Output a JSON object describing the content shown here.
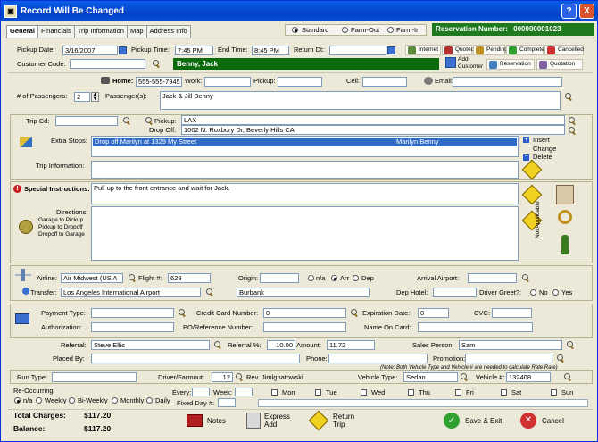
{
  "window": {
    "title": "Record Will Be Changed",
    "help": "?",
    "close": "X"
  },
  "tabs": [
    "General",
    "Financials",
    "Trip Information",
    "Map",
    "Address Info"
  ],
  "service_type": {
    "options": [
      "Standard",
      "Farm-Out",
      "Farm-In"
    ],
    "selected": "Standard"
  },
  "reservation": {
    "label": "Reservation Number:",
    "value": "000000001023"
  },
  "pickup": {
    "date_label": "Pickup Date:",
    "date": "3/16/2007",
    "time_label": "Pickup Time:",
    "time": "7:45 PM",
    "end_label": "End Time:",
    "end": "8:45 PM",
    "return_label": "Return Dt:",
    "return": ""
  },
  "status_buttons": {
    "internet": "Internet",
    "quoted": "Quoted",
    "pending": "Pending",
    "completed": "Completed",
    "cancelled": "Cancelled",
    "add_customer": "Add Customer",
    "reservation": "Reservation",
    "quotation": "Quotation"
  },
  "customer": {
    "code_label": "Customer Code:",
    "code": "",
    "name": "Benny, Jack",
    "home_label": "Home:",
    "home": "555-555-7945",
    "work_label": "Work:",
    "work": "",
    "pickup_label": "Pickup:",
    "pickup": "",
    "cell_label": "Cell:",
    "cell": "",
    "email_label": "Email:",
    "email": ""
  },
  "passengers": {
    "count_label": "# of Passengers:",
    "count": "2",
    "names_label": "Passenger(s):",
    "names": "Jack & Jill Benny"
  },
  "trip": {
    "cd_label": "Trip Cd:",
    "cd": "",
    "pickup_label": "Pickup:",
    "pickup": "LAX",
    "dropoff_label": "Drop Off:",
    "dropoff": "1002 N. Roxbury Dr, Beverly Hills CA",
    "extra_label": "Extra Stops:",
    "extra_stop": "Drop off Marilyn at 1329 My Street",
    "extra_stop_name": "Marilyn Benny",
    "insert": "Insert",
    "change": "Change",
    "delete": "Delete",
    "info_label": "Trip Information:"
  },
  "special": {
    "label": "Special Instructions:",
    "text": "Pull up to the front entrance and wait for Jack.",
    "directions_label": "Directions:",
    "dir1": "Garage to Pickup",
    "dir2": "Pickup to Dropoff",
    "dir3": "Dropoff to Garage",
    "not_applicable": "Not Applicable"
  },
  "flight": {
    "airline_label": "Airline:",
    "airline": "Air Midwest (US A",
    "flight_label": "Flight #:",
    "flight": "629",
    "origin_label": "Origin:",
    "origin": "",
    "na": "n/a",
    "arr": "Arr",
    "dep": "Dep",
    "arrival_label": "Arrival Airport:",
    "arrival": "",
    "transfer_label": "Transfer:",
    "transfer": "Los Angeles International Airport",
    "transfer2": "Burbank",
    "dep_hotel_label": "Dep Hotel:",
    "dep_hotel": "",
    "greet_label": "Driver Greet?:",
    "no": "No",
    "yes": "Yes"
  },
  "payment": {
    "type_label": "Payment Type:",
    "type": "",
    "cc_label": "Credit Card Number:",
    "cc": "0",
    "exp_label": "Expiration Date:",
    "exp": "0",
    "cvc_label": "CVC:",
    "cvc": "",
    "auth_label": "Authorization:",
    "auth": "",
    "po_label": "PO/Reference Number:",
    "po": "",
    "name_label": "Name On Card:",
    "name": ""
  },
  "referral": {
    "label": "Referral:",
    "value": "Steve Ellis",
    "pct_label": "Referral %:",
    "pct": "10.00",
    "amount_label": "Amount:",
    "amount": "11.72",
    "sales_label": "Sales Person:",
    "sales": "Sam",
    "placed_label": "Placed By:",
    "placed": "",
    "phone_label": "Phone:",
    "phone": "",
    "promo_label": "Promotion:",
    "promo": ""
  },
  "note": "(Note: Both Vehicle Type and Vehicle # are needed to calculate Rate Rate)",
  "run": {
    "type_label": "Run Type:",
    "type": "",
    "driver_label": "Driver/Farmout:",
    "driver_no": "12",
    "driver": "Rev. Jimlgnatowski",
    "vtype_label": "Vehicle Type:",
    "vtype": "Sedan",
    "vnum_label": "Vehicle #:",
    "vnum": "132408"
  },
  "recurring": {
    "label": "Re-Occurring",
    "options": [
      "n/a",
      "Weekly",
      "Bi-Weekly",
      "Monthly",
      "Daily"
    ],
    "selected": "n/a",
    "every_label": "Every:",
    "week_label": "Week:",
    "fixed_label": "Fixed Day #:",
    "days": [
      "Mon",
      "Tue",
      "Wed",
      "Thu",
      "Fri",
      "Sat",
      "Sun"
    ]
  },
  "totals": {
    "charges_label": "Total Charges:",
    "charges": "$117.20",
    "balance_label": "Balance:",
    "balance": "$117.20"
  },
  "actions": {
    "notes": "Notes",
    "express1": "Express",
    "express2": "Add",
    "return1": "Return",
    "return2": "Trip",
    "save": "Save & Exit",
    "cancel": "Cancel"
  },
  "colors": {
    "title": "#0342c8",
    "reservation_bg": "#1f7a1f",
    "name_bg": "#0b6a0b",
    "select": "#316ac5"
  }
}
